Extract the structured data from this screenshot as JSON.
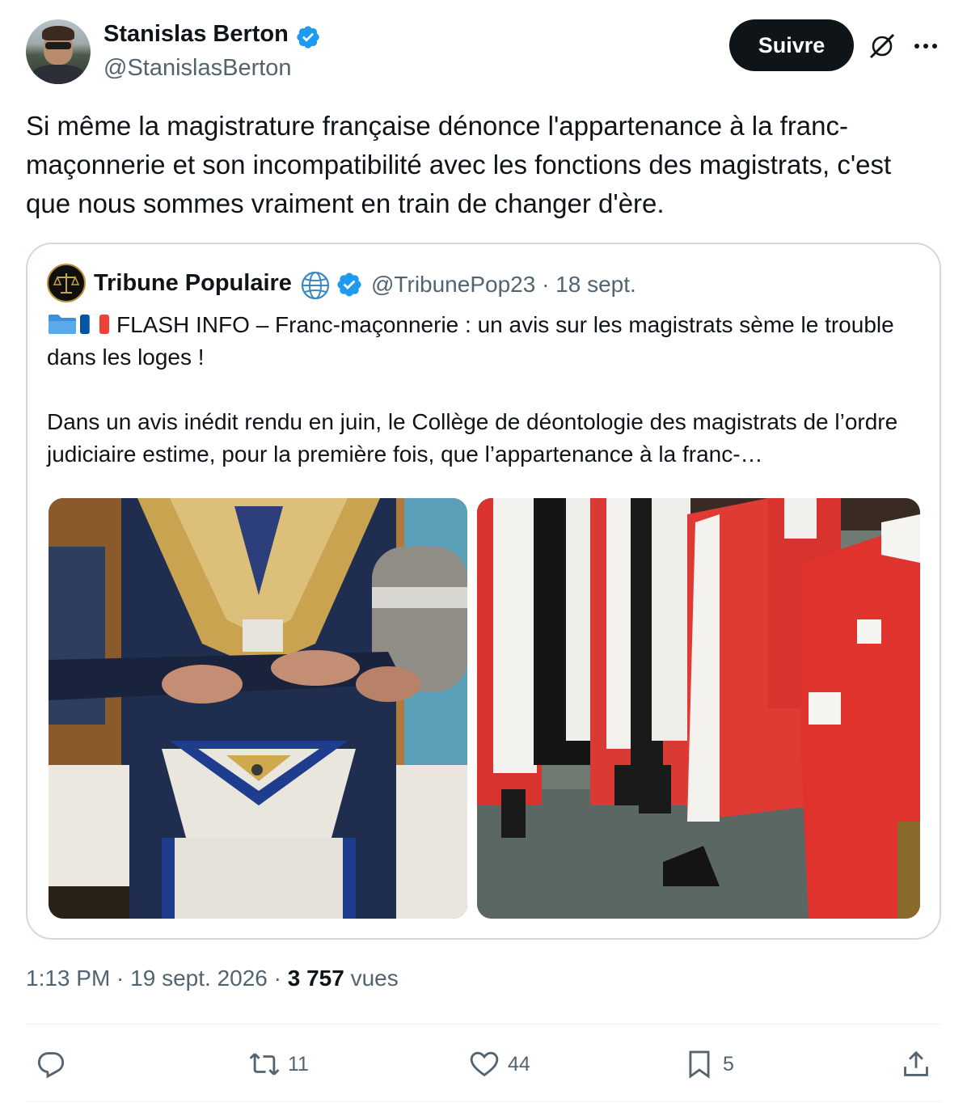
{
  "author": {
    "name": "Stanislas Berton",
    "handle": "@StanislasBerton",
    "verified": true
  },
  "follow_label": "Suivre",
  "tweet_text": "Si même la magistrature française dénonce l'appartenance à la franc-maçonnerie et son incompatibilité avec les fonctions des magistrats, c'est que nous sommes vraiment en train de changer d'ère.",
  "quote": {
    "name": "Tribune Populaire",
    "handle_date": "@TribunePop23 · 18 sept.",
    "paragraph1": "FLASH INFO – Franc-maçonnerie : un avis sur les magistrats sème le trouble dans les loges !",
    "paragraph2": "Dans un avis inédit rendu en juin, le Collège de déontologie des magistrats de l’ordre judiciaire estime, pour la première fois, que l’appartenance à la franc-…"
  },
  "meta": {
    "time_date": "1:13 PM · 19 sept. 2026 · ",
    "views_count": "3 757",
    "views_label": " vues"
  },
  "actions": {
    "reply_count": "",
    "retweet_count": "11",
    "like_count": "44",
    "bookmark_count": "5"
  },
  "colors": {
    "accent_blue": "#1d9bf0",
    "text_primary": "#0f1419",
    "text_secondary": "#536471",
    "border": "#cfd9de",
    "follow_bg": "#0f1419"
  },
  "icons": [
    "verified-badge-icon",
    "grok-icon",
    "more-icon",
    "globe-icon",
    "folder-icon",
    "french-flag-icon",
    "reply-icon",
    "retweet-icon",
    "like-icon",
    "bookmark-icon",
    "share-icon"
  ]
}
